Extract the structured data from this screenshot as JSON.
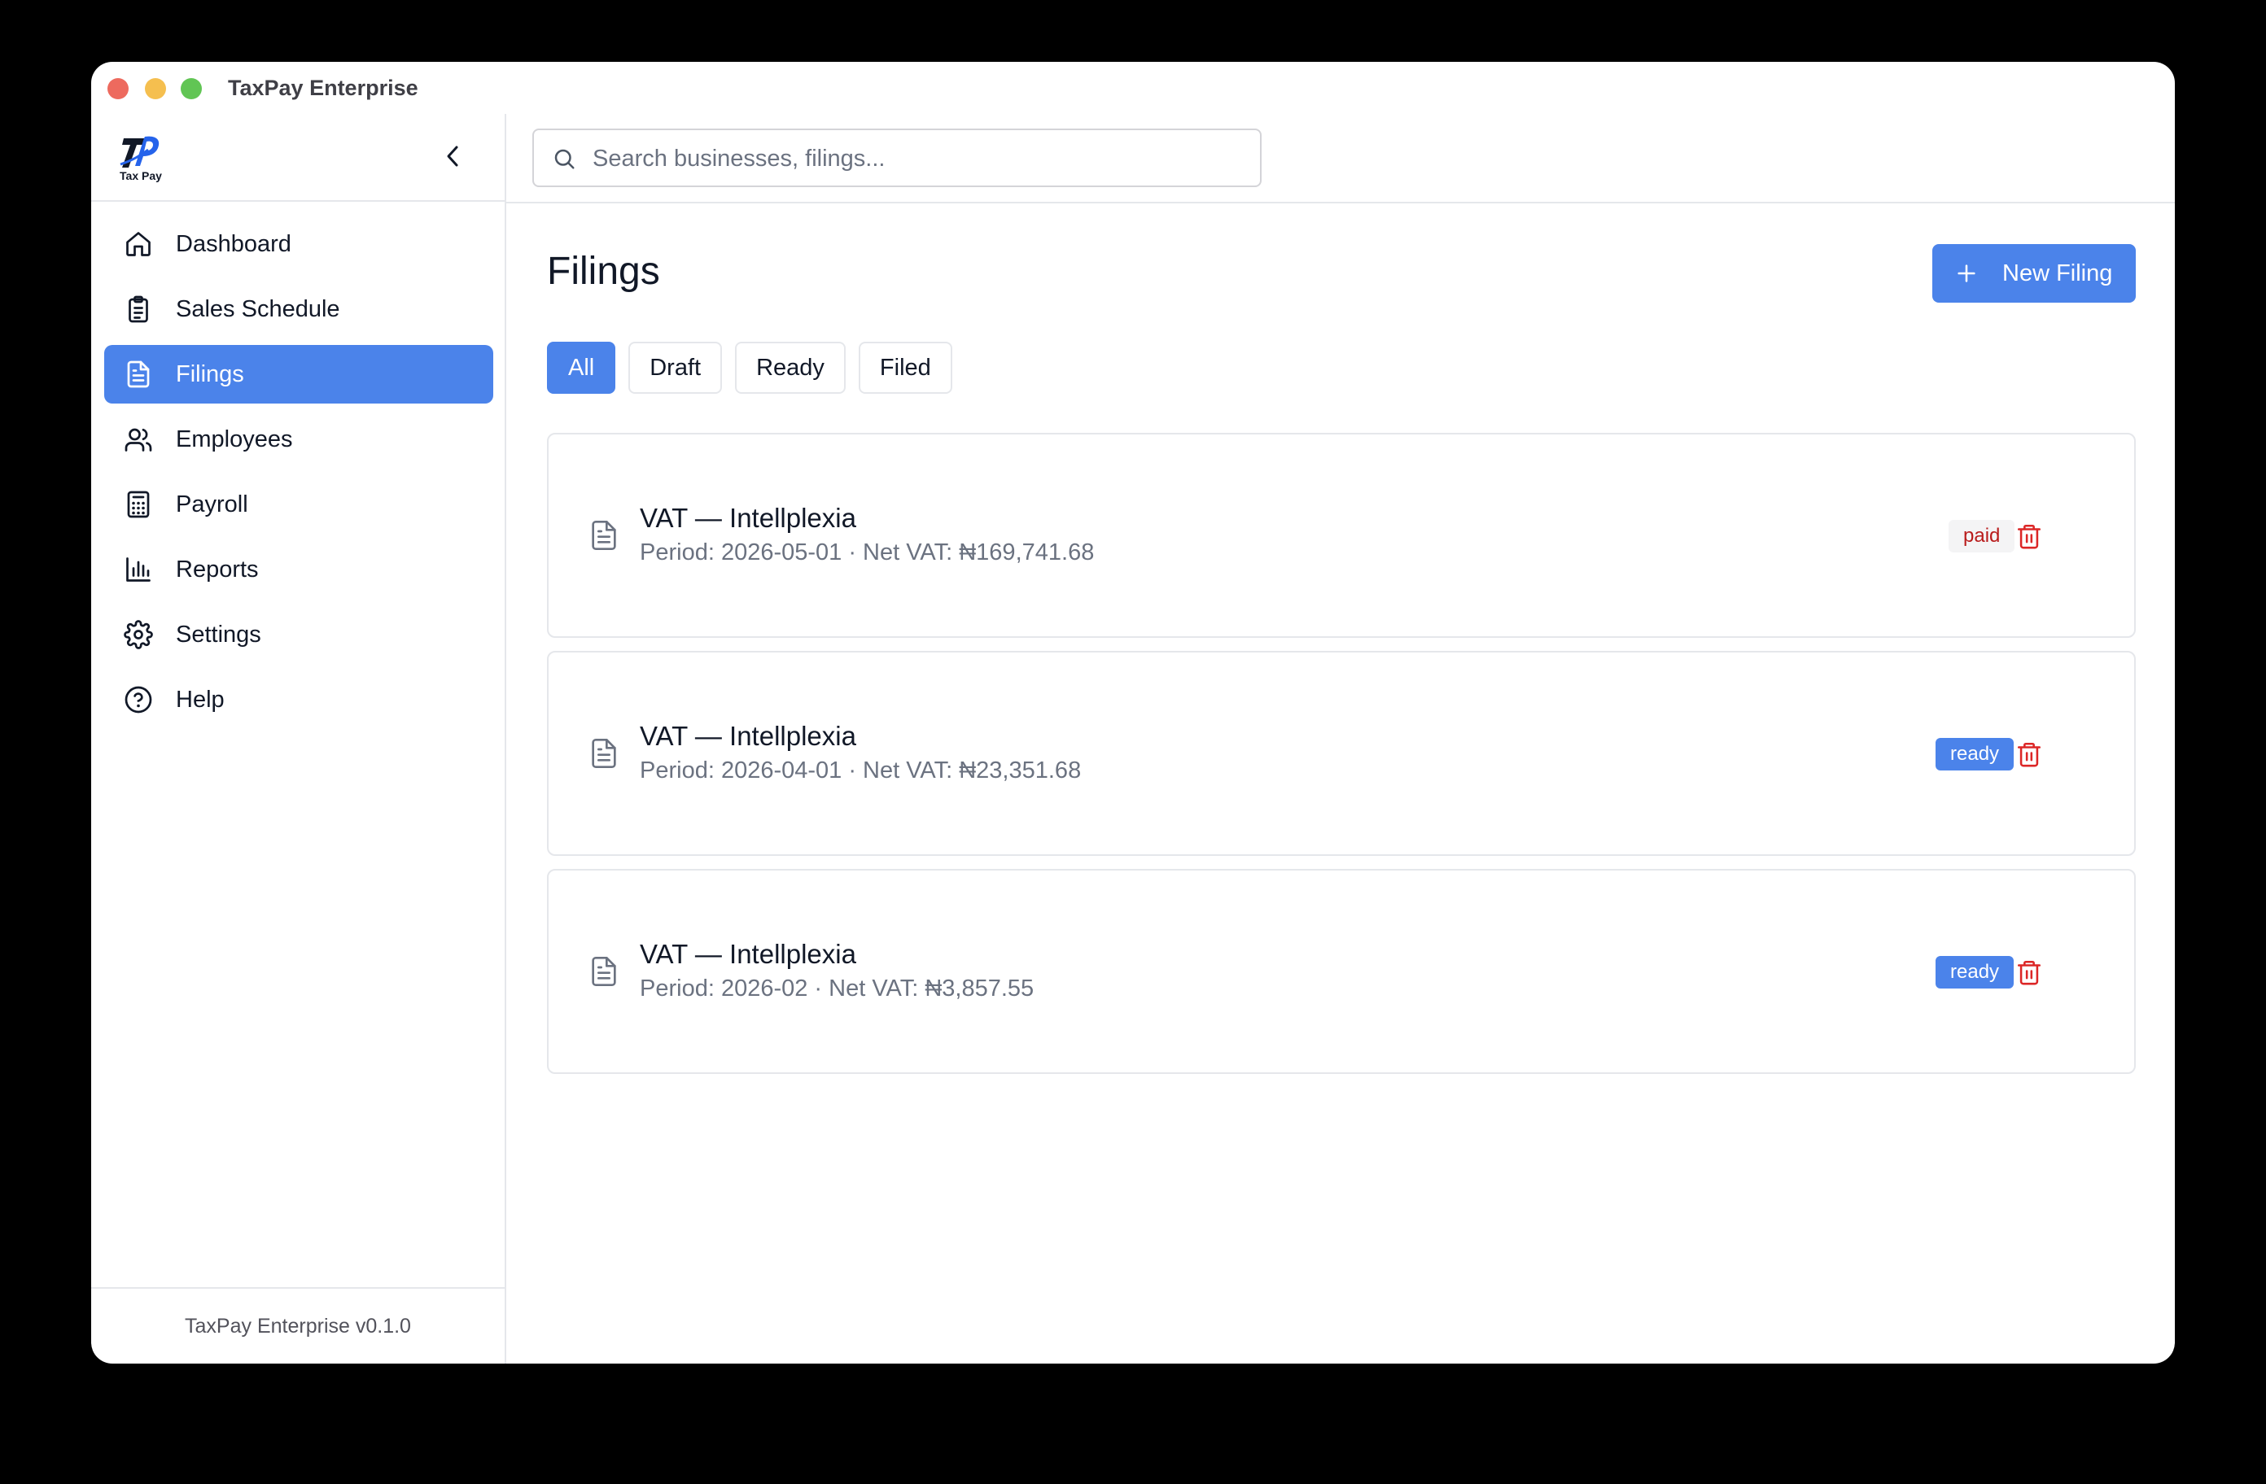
{
  "window": {
    "title": "TaxPay Enterprise"
  },
  "sidebar": {
    "logo_text": "Tax Pay",
    "items": [
      {
        "label": "Dashboard",
        "icon": "home-icon"
      },
      {
        "label": "Sales Schedule",
        "icon": "clipboard-icon"
      },
      {
        "label": "Filings",
        "icon": "document-icon",
        "active": true
      },
      {
        "label": "Employees",
        "icon": "users-icon"
      },
      {
        "label": "Payroll",
        "icon": "calculator-icon"
      },
      {
        "label": "Reports",
        "icon": "bar-chart-icon"
      },
      {
        "label": "Settings",
        "icon": "gear-icon"
      },
      {
        "label": "Help",
        "icon": "help-circle-icon"
      }
    ],
    "footer": "TaxPay Enterprise v0.1.0"
  },
  "search": {
    "placeholder": "Search businesses, filings...",
    "value": ""
  },
  "main": {
    "title": "Filings",
    "new_button": "New Filing",
    "filters": [
      {
        "label": "All",
        "active": true
      },
      {
        "label": "Draft"
      },
      {
        "label": "Ready"
      },
      {
        "label": "Filed"
      }
    ],
    "filings": [
      {
        "title": "VAT — Intellplexia",
        "subtitle": "Period: 2026-05-01 · Net VAT: ₦169,741.68",
        "status": "paid"
      },
      {
        "title": "VAT — Intellplexia",
        "subtitle": "Period: 2026-04-01 · Net VAT: ₦23,351.68",
        "status": "ready"
      },
      {
        "title": "VAT — Intellplexia",
        "subtitle": "Period: 2026-02 · Net VAT: ₦3,857.55",
        "status": "ready"
      }
    ]
  },
  "colors": {
    "accent": "#4b83ea",
    "danger": "#dc2626",
    "border": "#e5e7eb"
  }
}
